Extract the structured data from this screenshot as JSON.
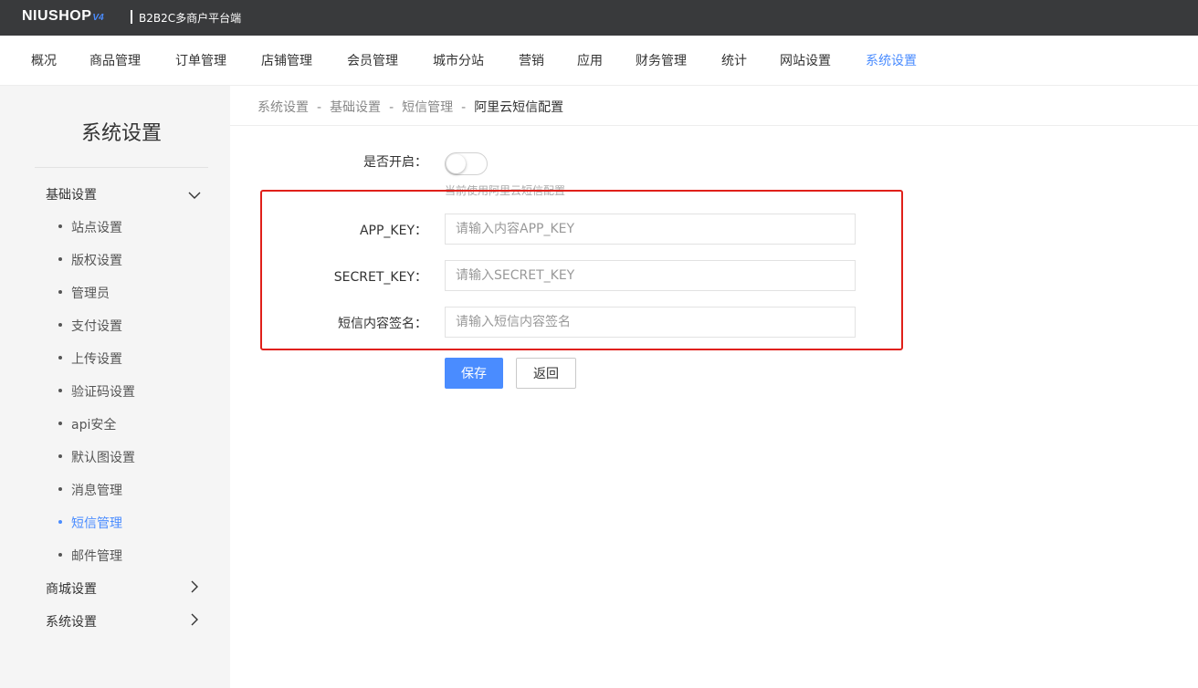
{
  "header": {
    "logo_text": "NIUSHOP",
    "logo_version": "V4",
    "platform_label": "B2B2C多商户平台端"
  },
  "mainnav": {
    "items": [
      {
        "label": "概况"
      },
      {
        "label": "商品管理"
      },
      {
        "label": "订单管理"
      },
      {
        "label": "店铺管理"
      },
      {
        "label": "会员管理"
      },
      {
        "label": "城市分站"
      },
      {
        "label": "营销"
      },
      {
        "label": "应用"
      },
      {
        "label": "财务管理"
      },
      {
        "label": "统计"
      },
      {
        "label": "网站设置"
      },
      {
        "label": "系统设置",
        "active": true
      }
    ]
  },
  "sidebar": {
    "title": "系统设置",
    "groups": [
      {
        "label": "基础设置",
        "expanded": true
      },
      {
        "label": "商城设置",
        "expanded": false
      },
      {
        "label": "系统设置",
        "expanded": false
      }
    ],
    "subitems": [
      {
        "label": "站点设置"
      },
      {
        "label": "版权设置"
      },
      {
        "label": "管理员"
      },
      {
        "label": "支付设置"
      },
      {
        "label": "上传设置"
      },
      {
        "label": "验证码设置"
      },
      {
        "label": "api安全"
      },
      {
        "label": "默认图设置"
      },
      {
        "label": "消息管理"
      },
      {
        "label": "短信管理",
        "active": true
      },
      {
        "label": "邮件管理"
      }
    ]
  },
  "breadcrumb": {
    "items": [
      "系统设置",
      "基础设置",
      "短信管理",
      "阿里云短信配置"
    ],
    "separator": "-"
  },
  "form": {
    "enable_label": "是否开启：",
    "enable_value": false,
    "enable_hint": "当前使用阿里云短信配置",
    "app_key_label": "APP_KEY：",
    "app_key_placeholder": "请输入内容APP_KEY",
    "secret_key_label": "SECRET_KEY：",
    "secret_key_placeholder": "请输入SECRET_KEY",
    "sign_label": "短信内容签名：",
    "sign_placeholder": "请输入短信内容签名",
    "save_label": "保存",
    "back_label": "返回"
  },
  "colors": {
    "accent": "#4a8cff",
    "topbar": "#393a3c",
    "highlight_box": "#e0201a"
  }
}
